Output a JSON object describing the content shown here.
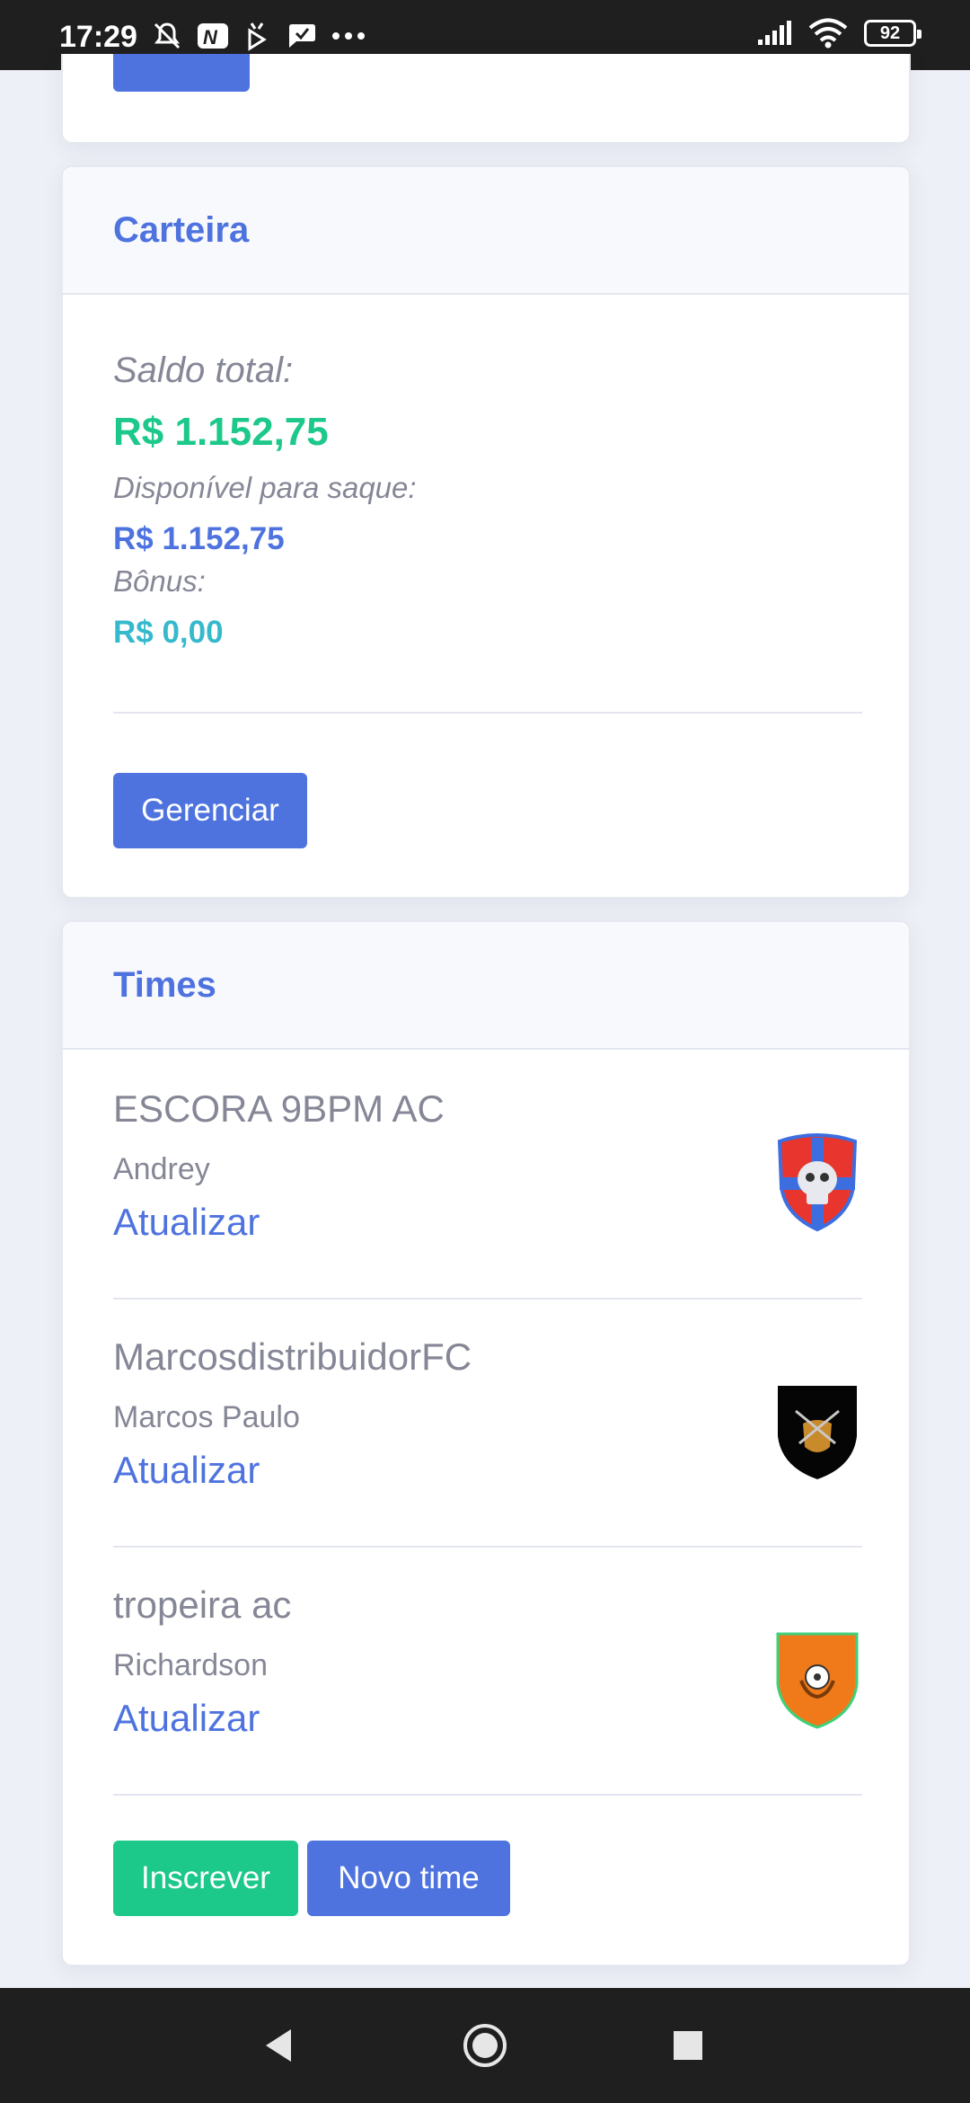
{
  "status_bar": {
    "time": "17:29",
    "battery": "92",
    "icons": [
      "mute-icon",
      "nu-app-icon",
      "tv-icon",
      "chat-heart-icon",
      "more-icon",
      "signal-icon",
      "wifi-icon",
      "battery-icon"
    ]
  },
  "wallet": {
    "title": "Carteira",
    "total_label": "Saldo total:",
    "total_value": "R$ 1.152,75",
    "available_label": "Disponível para saque:",
    "available_value": "R$ 1.152,75",
    "bonus_label": "Bônus:",
    "bonus_value": "R$ 0,00",
    "manage_label": "Gerenciar"
  },
  "teams": {
    "title": "Times",
    "items": [
      {
        "name": "ESCORA 9BPM AC",
        "owner": "Andrey",
        "action": "Atualizar",
        "badge": "skull-shield-icon"
      },
      {
        "name": "MarcosdistribuidorFC",
        "owner": "Marcos Paulo",
        "action": "Atualizar",
        "badge": "swords-shield-icon"
      },
      {
        "name": "tropeira ac",
        "owner": "Richardson",
        "action": "Atualizar",
        "badge": "ball-shield-icon"
      }
    ],
    "subscribe_label": "Inscrever",
    "new_team_label": "Novo time"
  },
  "colors": {
    "primary": "#4e73df",
    "success": "#1cc88a",
    "info": "#36b9cc",
    "muted": "#858796"
  }
}
